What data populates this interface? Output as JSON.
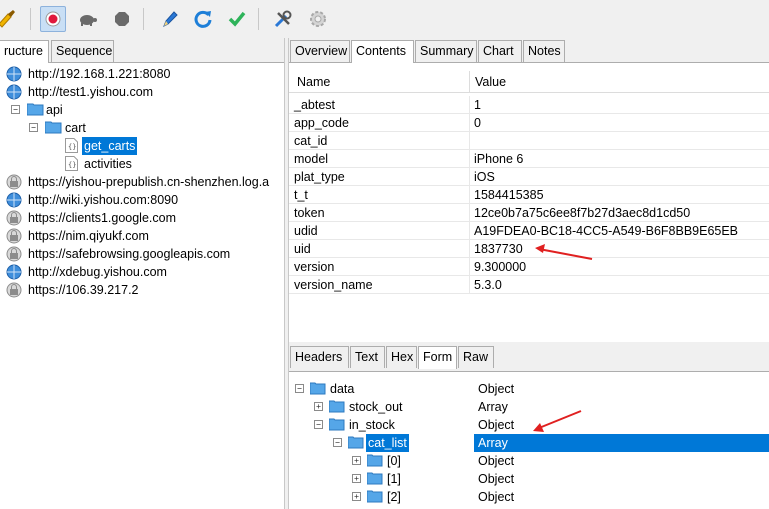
{
  "toolbar": {
    "icons": [
      "broom-icon",
      "record-icon",
      "turtle-icon",
      "stop-icon",
      "pen-icon",
      "refresh-icon",
      "check-icon",
      "tools-icon",
      "settings-icon"
    ]
  },
  "left": {
    "tabs": [
      "ructure",
      "Sequence"
    ],
    "tree": [
      {
        "label": "http://192.168.1.221:8080",
        "icon": "globe-icon"
      },
      {
        "label": "http://test1.yishou.com",
        "icon": "globe-icon"
      },
      {
        "label": "api",
        "icon": "folder-icon"
      },
      {
        "label": "cart",
        "icon": "folder-icon"
      },
      {
        "label": "get_carts",
        "icon": "json-file-icon"
      },
      {
        "label": "activities",
        "icon": "json-file-icon"
      },
      {
        "label": "https://yishou-prepublish.cn-shenzhen.log.a",
        "icon": "lock-globe-icon"
      },
      {
        "label": "http://wiki.yishou.com:8090",
        "icon": "globe-icon"
      },
      {
        "label": "https://clients1.google.com",
        "icon": "lock-globe-icon"
      },
      {
        "label": "https://nim.qiyukf.com",
        "icon": "lock-globe-icon"
      },
      {
        "label": "https://safebrowsing.googleapis.com",
        "icon": "lock-globe-icon"
      },
      {
        "label": "http://xdebug.yishou.com",
        "icon": "globe-icon"
      },
      {
        "label": "https://106.39.217.2",
        "icon": "lock-globe-icon"
      }
    ]
  },
  "right": {
    "tabs": [
      "Overview",
      "Contents",
      "Summary",
      "Chart",
      "Notes"
    ],
    "grid": {
      "headers": [
        "Name",
        "Value"
      ],
      "rows": [
        {
          "name": "_abtest",
          "value": "1"
        },
        {
          "name": "app_code",
          "value": "0"
        },
        {
          "name": "cat_id",
          "value": ""
        },
        {
          "name": "model",
          "value": "iPhone 6"
        },
        {
          "name": "plat_type",
          "value": "iOS"
        },
        {
          "name": "t_t",
          "value": "1584415385"
        },
        {
          "name": "token",
          "value": "12ce0b7a75c6ee8f7b27d3aec8d1cd50"
        },
        {
          "name": "udid",
          "value": "A19FDEA0-BC18-4CC5-A549-B6F8BB9E65EB"
        },
        {
          "name": "uid",
          "value": "1837730"
        },
        {
          "name": "version",
          "value": "9.300000"
        },
        {
          "name": "version_name",
          "value": "5.3.0"
        }
      ]
    },
    "bottom_tabs": [
      "Headers",
      "Text",
      "Hex",
      "Form",
      "Raw"
    ],
    "form_tree": [
      {
        "key": "data",
        "type": "Object",
        "expander": "−"
      },
      {
        "key": "stock_out",
        "type": "Array",
        "expander": "+"
      },
      {
        "key": "in_stock",
        "type": "Object",
        "expander": "−"
      },
      {
        "key": "cat_list",
        "type": "Array",
        "expander": "−"
      },
      {
        "key": "[0]",
        "type": "Object",
        "expander": "+"
      },
      {
        "key": "[1]",
        "type": "Object",
        "expander": "+"
      },
      {
        "key": "[2]",
        "type": "Object",
        "expander": "+"
      }
    ]
  },
  "colors": {
    "accent": "#0078d7",
    "annotation_arrow": "#e02020"
  }
}
